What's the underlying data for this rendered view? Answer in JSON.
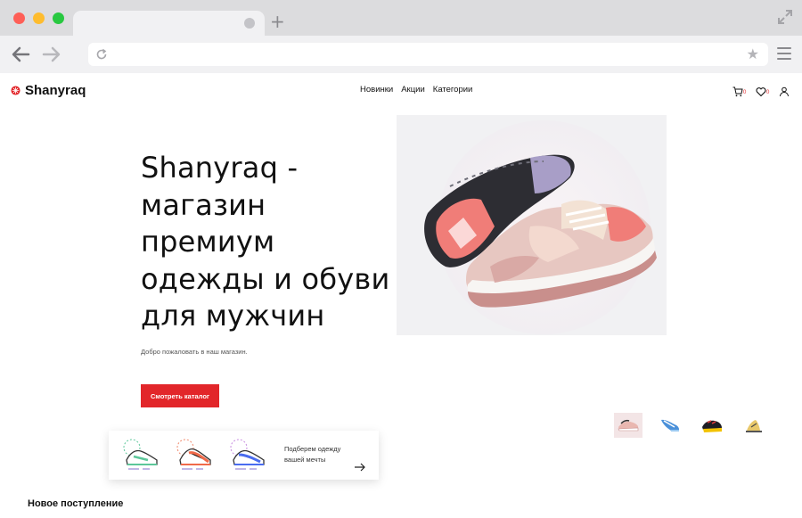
{
  "browser": {
    "url": "",
    "colors": {
      "close": "#fe5f57",
      "minimize": "#febc2e",
      "maximize": "#28c840"
    }
  },
  "site": {
    "logo_text": "Shanyraq",
    "nav": [
      "Новинки",
      "Акции",
      "Категории"
    ],
    "cart_count": "0",
    "wishlist_count": "0",
    "accent_color": "#e2262a"
  },
  "hero": {
    "title": "Shanyraq - магазин премиум одежды и обуви для мужчин",
    "subtitle": "Добро пожаловать в наш магазин.",
    "cta_label": "Смотреть каталог",
    "thumbnails": [
      "pink-sneaker",
      "blue-sneaker",
      "black-sneaker",
      "yellow-sneaker"
    ]
  },
  "feature_card": {
    "text": "Подберем одежду вашей мечты"
  },
  "sections": {
    "new_arrivals": "Новое поступление"
  }
}
